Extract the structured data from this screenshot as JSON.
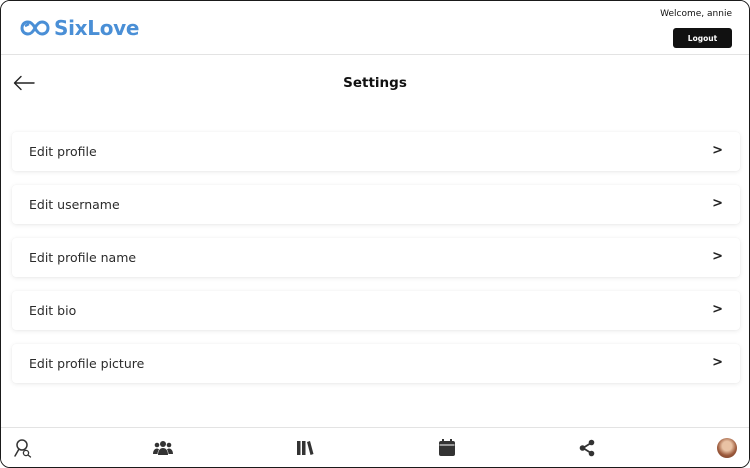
{
  "header": {
    "brand": "SixLove",
    "brand_color": "#4a8fd6",
    "welcome": "Welcome, annie",
    "logout_label": "Logout"
  },
  "page": {
    "title": "Settings",
    "back_icon": "arrow-left-icon"
  },
  "settings": {
    "items": [
      {
        "label": "Edit profile",
        "chevron": ">"
      },
      {
        "label": "Edit username",
        "chevron": ">"
      },
      {
        "label": "Edit profile name",
        "chevron": ">"
      },
      {
        "label": "Edit bio",
        "chevron": ">"
      },
      {
        "label": "Edit profile picture",
        "chevron": ">"
      }
    ]
  },
  "bottom_nav": {
    "items": [
      {
        "icon": "search-user-icon"
      },
      {
        "icon": "group-icon"
      },
      {
        "icon": "library-icon"
      },
      {
        "icon": "calendar-icon"
      },
      {
        "icon": "share-icon"
      },
      {
        "icon": "avatar"
      }
    ]
  }
}
